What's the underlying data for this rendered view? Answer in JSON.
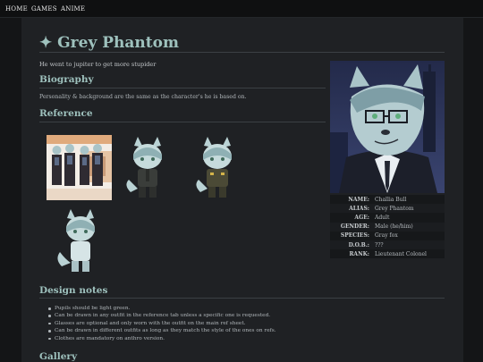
{
  "nav": {
    "items": [
      "HOME",
      "GAMES",
      "ANIME"
    ]
  },
  "header": {
    "title": "✦ Grey Phantom",
    "tagline": "He went to jupiter to get more stupider"
  },
  "biography": {
    "heading": "Biography",
    "text": "Personality & background are the same as the character's he is based on."
  },
  "reference": {
    "heading": "Reference"
  },
  "infobox": {
    "rows": [
      {
        "key": "NAME:",
        "value": "Challia Bull"
      },
      {
        "key": "ALIAS:",
        "value": "Grey Phantom"
      },
      {
        "key": "AGE:",
        "value": "Adult"
      },
      {
        "key": "GENDER:",
        "value": "Male (he/him)"
      },
      {
        "key": "SPECIES:",
        "value": "Gray fox"
      },
      {
        "key": "D.O.B.:",
        "value": "???"
      },
      {
        "key": "RANK:",
        "value": "Lieutenant Colonel"
      }
    ]
  },
  "design_notes": {
    "heading": "Design notes",
    "items": [
      "Pupils should be light green.",
      "Can be drawn in any outfit in the reference tab unless a specific one is requested.",
      "Glasses are optional and only worn with the outfit on the main ref sheet.",
      "Can be drawn in different outfits as long as they match the style of the ones on refs.",
      "Clothes are mandatory on anthro version."
    ]
  },
  "gallery": {
    "heading": "Gallery"
  },
  "colors": {
    "accent": "#9ec1bd",
    "background": "#141517",
    "panel": "#1f2124",
    "fur": "#a9c4c8"
  },
  "icons": {
    "title_star": "sparkle-icon",
    "bullet": "disc-bullet-icon"
  }
}
